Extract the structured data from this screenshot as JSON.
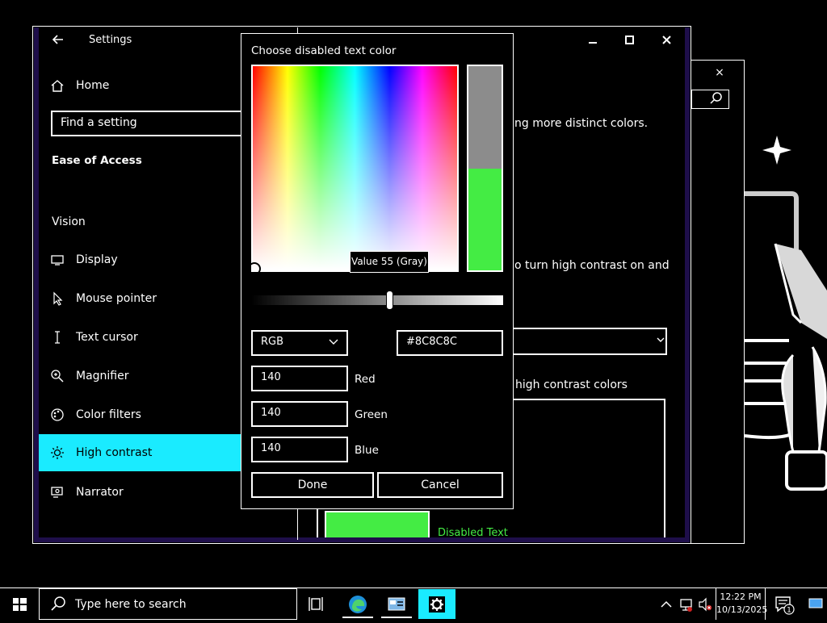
{
  "background_window": {
    "close_label": "×"
  },
  "settings": {
    "title": "Settings",
    "home_label": "Home",
    "search_placeholder": "Find a setting",
    "section_heading": "Ease of Access",
    "group_label": "Vision",
    "nav_items": [
      {
        "label": "Display",
        "icon": "monitor-icon"
      },
      {
        "label": "Mouse pointer",
        "icon": "mouse-pointer-icon"
      },
      {
        "label": "Text cursor",
        "icon": "text-cursor-icon"
      },
      {
        "label": "Magnifier",
        "icon": "magnifier-icon"
      },
      {
        "label": "Color filters",
        "icon": "color-filters-icon"
      },
      {
        "label": "High contrast",
        "icon": "brightness-icon"
      },
      {
        "label": "Narrator",
        "icon": "narrator-icon"
      }
    ],
    "active_item": "High contrast",
    "pane": {
      "text_1": "ng more distinct colors.",
      "text_2": "o turn high contrast on and",
      "text_3": "high contrast colors",
      "preview_label": "Disabled Text"
    },
    "colors": {
      "accent": "#1aebff",
      "disabled_text": "#44ec44",
      "frame": "#1e0e4a"
    }
  },
  "color_dialog": {
    "title": "Choose disabled text color",
    "tooltip": "Value 55 (Gray)",
    "mode": "RGB",
    "hex": "#8C8C8C",
    "red": "140",
    "red_label": "Red",
    "green": "140",
    "green_label": "Green",
    "blue": "140",
    "blue_label": "Blue",
    "done_label": "Done",
    "cancel_label": "Cancel",
    "value_slider": 0.55,
    "selected_color": "#8c8c8c",
    "new_color": "#44ec44"
  },
  "taskbar": {
    "search_placeholder": "Type here to search",
    "time": "12:22 PM",
    "date": "10/13/2025",
    "notification_count": "1"
  }
}
